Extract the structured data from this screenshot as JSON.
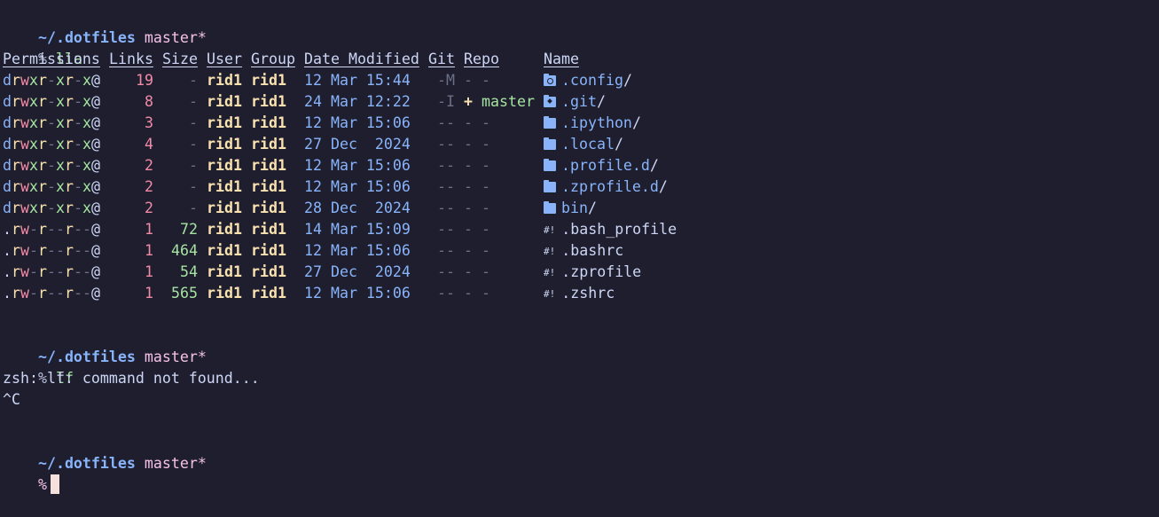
{
  "colors": {
    "background": "#1e1e2e",
    "cwd": "#89b4fa",
    "branch": "#f5c2e7",
    "command": "#a6e3a1",
    "perm_read": "#f9e2af",
    "perm_write": "#f38ba8",
    "perm_exec": "#a6e3a1",
    "user": "#f9e2af",
    "date": "#89b4fa",
    "cursor": "#f5e0dc"
  },
  "blocks": [
    {
      "prompt": {
        "cwd": "~/.dotfiles",
        "branch": "master*",
        "symbol": "%",
        "command": "lla"
      }
    },
    {
      "prompt": {
        "cwd": "~/.dotfiles",
        "branch": "master*",
        "symbol": "%",
        "command": "lf"
      },
      "output": [
        "zsh: lf: command not found...",
        "^C"
      ]
    },
    {
      "prompt": {
        "cwd": "~/.dotfiles",
        "branch": "master*",
        "symbol": "%",
        "command": ""
      }
    }
  ],
  "listing": {
    "headers": {
      "permissions": "Permissions",
      "links": "Links",
      "size": "Size",
      "user": "User",
      "group": "Group",
      "date": "Date Modified",
      "git": "Git",
      "repo": "Repo",
      "name": "Name"
    },
    "rows": [
      {
        "type": "d",
        "perm": [
          "r",
          "w",
          "x",
          "r",
          "-",
          "x",
          "r",
          "-",
          "x"
        ],
        "attr": "@",
        "links": "19",
        "size": "-",
        "user": "rid1",
        "group": "rid1",
        "date": "12 Mar 15:44",
        "git": "-M",
        "repo": "- -",
        "repo_plus": "",
        "repo_branch": "",
        "icon": "gear-folder-icon",
        "name": ".config",
        "slash": "/"
      },
      {
        "type": "d",
        "perm": [
          "r",
          "w",
          "x",
          "r",
          "-",
          "x",
          "r",
          "-",
          "x"
        ],
        "attr": "@",
        "links": "8",
        "size": "-",
        "user": "rid1",
        "group": "rid1",
        "date": "24 Mar 12:22",
        "git": "-I",
        "repo": "",
        "repo_plus": "+",
        "repo_branch": "master",
        "icon": "git-folder-icon",
        "name": ".git",
        "slash": "/"
      },
      {
        "type": "d",
        "perm": [
          "r",
          "w",
          "x",
          "r",
          "-",
          "x",
          "r",
          "-",
          "x"
        ],
        "attr": "@",
        "links": "3",
        "size": "-",
        "user": "rid1",
        "group": "rid1",
        "date": "12 Mar 15:06",
        "git": "--",
        "repo": "- -",
        "repo_plus": "",
        "repo_branch": "",
        "icon": "folder-icon",
        "name": ".ipython",
        "slash": "/"
      },
      {
        "type": "d",
        "perm": [
          "r",
          "w",
          "x",
          "r",
          "-",
          "x",
          "r",
          "-",
          "x"
        ],
        "attr": "@",
        "links": "4",
        "size": "-",
        "user": "rid1",
        "group": "rid1",
        "date": "27 Dec  2024",
        "git": "--",
        "repo": "- -",
        "repo_plus": "",
        "repo_branch": "",
        "icon": "folder-icon",
        "name": ".local",
        "slash": "/"
      },
      {
        "type": "d",
        "perm": [
          "r",
          "w",
          "x",
          "r",
          "-",
          "x",
          "r",
          "-",
          "x"
        ],
        "attr": "@",
        "links": "2",
        "size": "-",
        "user": "rid1",
        "group": "rid1",
        "date": "12 Mar 15:06",
        "git": "--",
        "repo": "- -",
        "repo_plus": "",
        "repo_branch": "",
        "icon": "folder-icon",
        "name": ".profile.d",
        "slash": "/"
      },
      {
        "type": "d",
        "perm": [
          "r",
          "w",
          "x",
          "r",
          "-",
          "x",
          "r",
          "-",
          "x"
        ],
        "attr": "@",
        "links": "2",
        "size": "-",
        "user": "rid1",
        "group": "rid1",
        "date": "12 Mar 15:06",
        "git": "--",
        "repo": "- -",
        "repo_plus": "",
        "repo_branch": "",
        "icon": "folder-icon",
        "name": ".zprofile.d",
        "slash": "/"
      },
      {
        "type": "d",
        "perm": [
          "r",
          "w",
          "x",
          "r",
          "-",
          "x",
          "r",
          "-",
          "x"
        ],
        "attr": "@",
        "links": "2",
        "size": "-",
        "user": "rid1",
        "group": "rid1",
        "date": "28 Dec  2024",
        "git": "--",
        "repo": "- -",
        "repo_plus": "",
        "repo_branch": "",
        "icon": "folder-icon",
        "name": "bin",
        "slash": "/"
      },
      {
        "type": ".",
        "perm": [
          "r",
          "w",
          "-",
          "r",
          "-",
          "-",
          "r",
          "-",
          "-"
        ],
        "attr": "@",
        "links": "1",
        "size": "72",
        "user": "rid1",
        "group": "rid1",
        "date": "14 Mar 15:09",
        "git": "--",
        "repo": "- -",
        "repo_plus": "",
        "repo_branch": "",
        "icon": "shebang-icon",
        "name": ".bash_profile",
        "slash": ""
      },
      {
        "type": ".",
        "perm": [
          "r",
          "w",
          "-",
          "r",
          "-",
          "-",
          "r",
          "-",
          "-"
        ],
        "attr": "@",
        "links": "1",
        "size": "464",
        "user": "rid1",
        "group": "rid1",
        "date": "12 Mar 15:06",
        "git": "--",
        "repo": "- -",
        "repo_plus": "",
        "repo_branch": "",
        "icon": "shebang-icon",
        "name": ".bashrc",
        "slash": ""
      },
      {
        "type": ".",
        "perm": [
          "r",
          "w",
          "-",
          "r",
          "-",
          "-",
          "r",
          "-",
          "-"
        ],
        "attr": "@",
        "links": "1",
        "size": "54",
        "user": "rid1",
        "group": "rid1",
        "date": "27 Dec  2024",
        "git": "--",
        "repo": "- -",
        "repo_plus": "",
        "repo_branch": "",
        "icon": "shebang-icon",
        "name": ".zprofile",
        "slash": ""
      },
      {
        "type": ".",
        "perm": [
          "r",
          "w",
          "-",
          "r",
          "-",
          "-",
          "r",
          "-",
          "-"
        ],
        "attr": "@",
        "links": "1",
        "size": "565",
        "user": "rid1",
        "group": "rid1",
        "date": "12 Mar 15:06",
        "git": "--",
        "repo": "- -",
        "repo_plus": "",
        "repo_branch": "",
        "icon": "shebang-icon",
        "name": ".zshrc",
        "slash": ""
      }
    ]
  },
  "icon_glyphs": {
    "shebang-icon": "#!"
  }
}
